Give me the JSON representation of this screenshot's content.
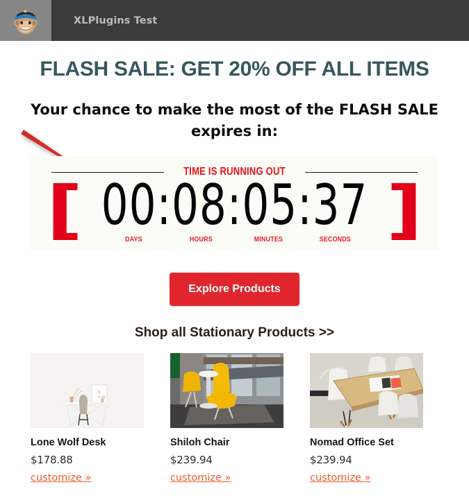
{
  "header": {
    "logo_icon": "mailchimp-freddie-icon",
    "title": "XLPlugins Test"
  },
  "campaign": {
    "headline": "FLASH SALE: GET 20% OFF ALL ITEMS",
    "subheadline": "Your chance to make the most of the FLASH SALE expires in:"
  },
  "countdown": {
    "title": "TIME IS RUNNING OUT",
    "bracket_left": "[",
    "bracket_right": "]",
    "display": "00:08:05:37",
    "days": "00",
    "hours": "08",
    "minutes": "05",
    "seconds": "37",
    "labels": {
      "days": "DAYS",
      "hours": "HOURS",
      "minutes": "MINUTES",
      "seconds": "SECONDS"
    },
    "accent_color": "#e8131b",
    "panel_bg": "#fbfcf6"
  },
  "annotation": {
    "arrow_icon": "red-arrow-icon",
    "arrow_color": "#d62b26"
  },
  "cta": {
    "label": "Explore Products",
    "color": "#e0262c"
  },
  "shop_all": {
    "label": "Shop all Stationary Products >>"
  },
  "products": [
    {
      "image_icon": "desk-photo",
      "name": "Lone Wolf Desk",
      "price": "$178.88",
      "link_label": "customize »"
    },
    {
      "image_icon": "chair-photo",
      "name": "Shiloh Chair",
      "price": "$239.94",
      "link_label": "customize »"
    },
    {
      "image_icon": "office-set-photo",
      "name": "Nomad Office Set",
      "price": "$239.94",
      "link_label": "customize »"
    }
  ]
}
